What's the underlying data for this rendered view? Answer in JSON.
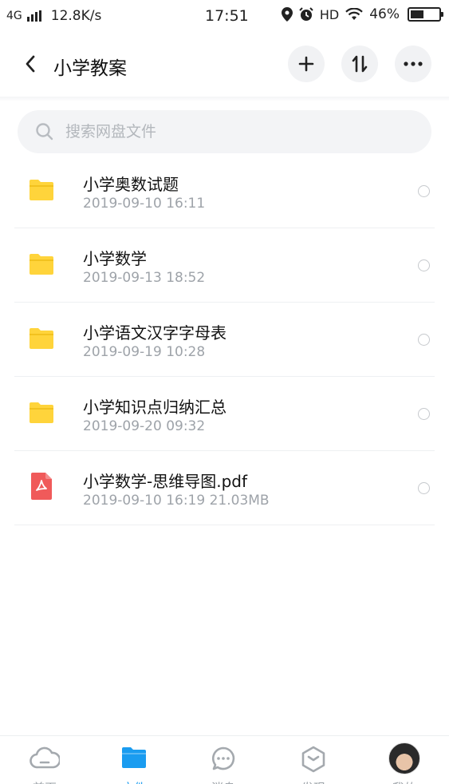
{
  "status_bar": {
    "network": "4G",
    "speed": "12.8K/s",
    "time": "17:51",
    "hd": "HD",
    "battery_percent": "46%",
    "battery_level": 0.46
  },
  "header": {
    "title": "小学教案",
    "back_icon": "chevron-left-icon",
    "actions": [
      "plus-icon",
      "sort-icon",
      "more-icon"
    ]
  },
  "search": {
    "placeholder": "搜索网盘文件",
    "value": ""
  },
  "files": [
    {
      "name": "小学奥数试题",
      "meta": "2019-09-10  16:11",
      "type": "folder",
      "selected": false
    },
    {
      "name": "小学数学",
      "meta": "2019-09-13  18:52",
      "type": "folder",
      "selected": false
    },
    {
      "name": "小学语文汉字字母表",
      "meta": "2019-09-19  10:28",
      "type": "folder",
      "selected": false
    },
    {
      "name": "小学知识点归纳汇总",
      "meta": "2019-09-20  09:32",
      "type": "folder",
      "selected": false
    },
    {
      "name": "小学数学-思维导图.pdf",
      "meta": "2019-09-10  16:19  21.03MB",
      "type": "pdf",
      "selected": false
    }
  ],
  "colors": {
    "folder": "#FFD43B",
    "pdf": "#F05A5A",
    "accent": "#1A9CF0"
  },
  "tabs": [
    {
      "label": "首页",
      "icon": "cloud-icon",
      "active": false
    },
    {
      "label": "文件",
      "icon": "folder-icon",
      "active": true
    },
    {
      "label": "消息",
      "icon": "chat-icon",
      "active": false
    },
    {
      "label": "发现",
      "icon": "hexagon-icon",
      "active": false
    },
    {
      "label": "我的",
      "icon": "avatar",
      "active": false
    }
  ]
}
